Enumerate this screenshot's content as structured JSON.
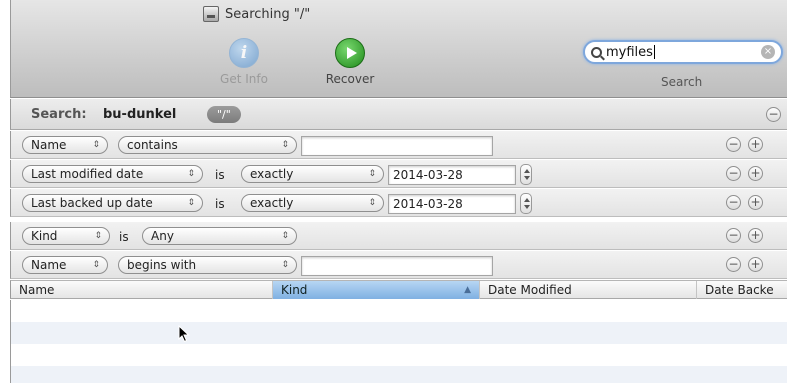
{
  "window": {
    "title": "Searching \"/\""
  },
  "toolbar": {
    "get_info_label": "Get Info",
    "recover_label": "Recover",
    "info_glyph": "i"
  },
  "search": {
    "value": "myfiles",
    "caption": "Search",
    "clear_glyph": "×"
  },
  "search_header": {
    "label": "Search:",
    "value": "bu-dunkel",
    "scope": "\"/\""
  },
  "criteria": [
    {
      "attribute": "Name",
      "operator": "contains",
      "value": ""
    },
    {
      "attribute": "Last modified date",
      "is": "is",
      "operator": "exactly",
      "value": "2014-03-28"
    },
    {
      "attribute": "Last backed up date",
      "is": "is",
      "operator": "exactly",
      "value": "2014-03-28"
    },
    {
      "attribute": "Kind",
      "is": "is",
      "operator": "Any"
    },
    {
      "attribute": "Name",
      "operator": "begins with",
      "value": ""
    }
  ],
  "columns": {
    "name": "Name",
    "kind": "Kind",
    "date_modified": "Date Modified",
    "date_backed": "Date Backe"
  },
  "glyphs": {
    "popup_arrows": "⇕",
    "minus": "−",
    "plus": "+",
    "sort_asc": "▲"
  },
  "colors": {
    "accent_blue": "#7fb0e2",
    "recover_green": "#1f8a1a",
    "info_blue": "#6f9fd0"
  }
}
